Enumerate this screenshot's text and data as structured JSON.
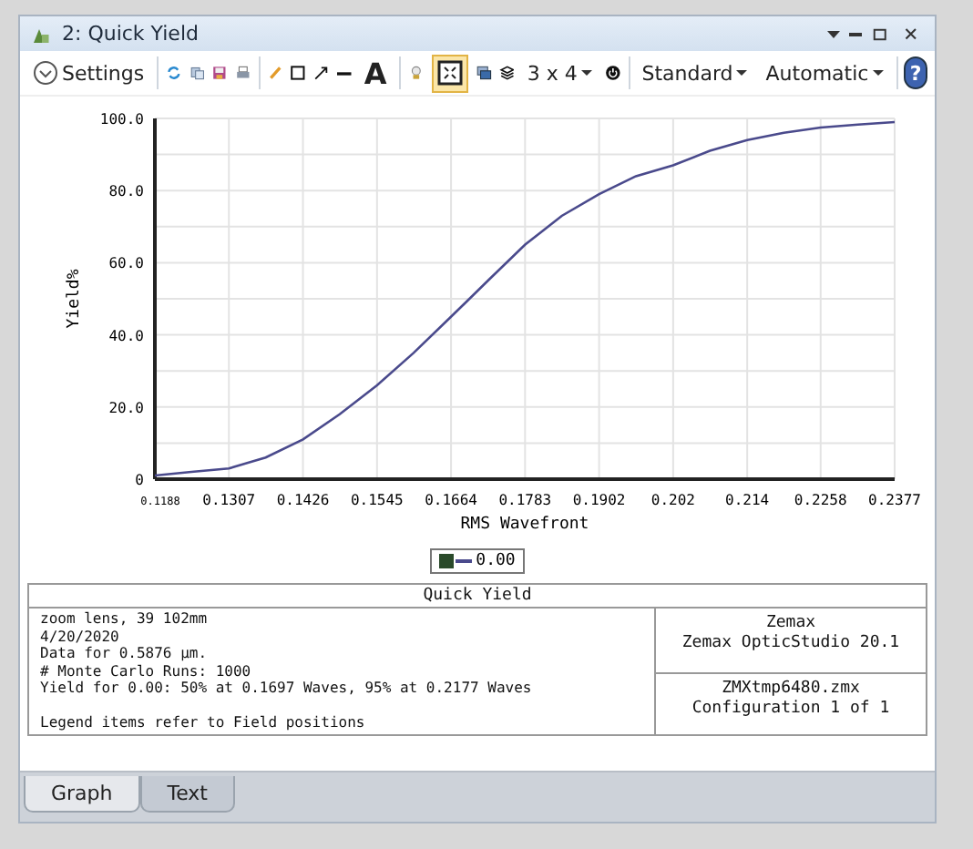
{
  "window": {
    "title": "2: Quick Yield"
  },
  "toolbar": {
    "settings": "Settings",
    "text_tool": "A",
    "fit_selected": true,
    "layout": "3 x 4",
    "dropdowns": [
      "Standard",
      "Automatic"
    ],
    "help": "?"
  },
  "chart_data": {
    "type": "line",
    "xlabel": "RMS Wavefront",
    "ylabel": "Yield%",
    "grid": true,
    "xlim": [
      0.1188,
      0.2377
    ],
    "ylim": [
      0,
      100
    ],
    "xticks": [
      {
        "value": 0.1188,
        "label": "0.1188"
      },
      {
        "value": 0.1307,
        "label": "0.1307"
      },
      {
        "value": 0.1426,
        "label": "0.1426"
      },
      {
        "value": 0.1545,
        "label": "0.1545"
      },
      {
        "value": 0.1664,
        "label": "0.1664"
      },
      {
        "value": 0.1783,
        "label": "0.1783"
      },
      {
        "value": 0.1902,
        "label": "0.1902"
      },
      {
        "value": 0.2021,
        "label": "0.202"
      },
      {
        "value": 0.214,
        "label": "0.214"
      },
      {
        "value": 0.2258,
        "label": "0.2258"
      },
      {
        "value": 0.2377,
        "label": "0.2377"
      }
    ],
    "yticks": [
      {
        "value": 0,
        "label": "0"
      },
      {
        "value": 20,
        "label": "20.0"
      },
      {
        "value": 40,
        "label": "40.0"
      },
      {
        "value": 60,
        "label": "60.0"
      },
      {
        "value": 80,
        "label": "80.0"
      },
      {
        "value": 100,
        "label": "100.0"
      }
    ],
    "x": [
      0.1188,
      0.1247,
      0.1307,
      0.1366,
      0.1426,
      0.1485,
      0.1545,
      0.1604,
      0.1664,
      0.1723,
      0.1783,
      0.1842,
      0.1902,
      0.1961,
      0.2021,
      0.208,
      0.214,
      0.2199,
      0.2258,
      0.2318,
      0.2377
    ],
    "series": [
      {
        "name": "0.00",
        "color": "#4a4a8c",
        "values": [
          1,
          2,
          3,
          6,
          11,
          18,
          26,
          35,
          45,
          55,
          65,
          73,
          79,
          84,
          87,
          91,
          94,
          96,
          97.5,
          98.3,
          99
        ]
      }
    ]
  },
  "info": {
    "title": "Quick Yield",
    "lines": [
      "zoom lens, 39 102mm",
      "4/20/2020",
      "Data for 0.5876 µm.",
      "# Monte Carlo Runs: 1000",
      "Yield for 0.00: 50% at 0.1697 Waves, 95% at 0.2177 Waves"
    ],
    "footer": "Legend items refer to Field positions",
    "company": [
      "Zemax",
      "Zemax OpticStudio 20.1"
    ],
    "file": [
      "ZMXtmp6480.zmx",
      "Configuration 1 of 1"
    ]
  },
  "tabs": [
    {
      "label": "Graph",
      "selected": true
    },
    {
      "label": "Text",
      "selected": false
    }
  ]
}
